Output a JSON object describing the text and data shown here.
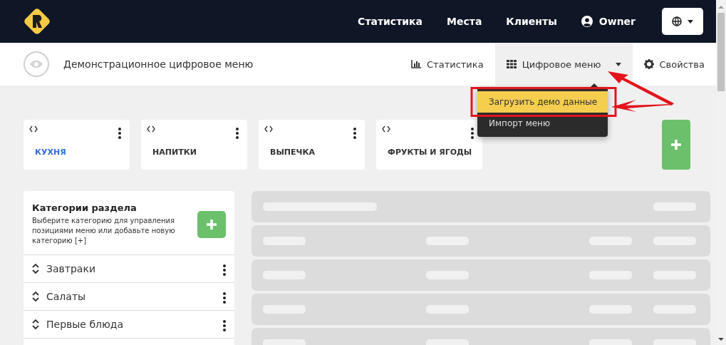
{
  "topbar": {
    "nav": [
      {
        "label": "Статистика"
      },
      {
        "label": "Места"
      },
      {
        "label": "Клиенты"
      }
    ],
    "user": "Owner"
  },
  "subheader": {
    "title": "Демонстрационное цифровое меню",
    "tabs": [
      {
        "label": "Статистика",
        "kind": "chart",
        "selected": false
      },
      {
        "label": "Цифровое меню",
        "kind": "grid",
        "selected": true,
        "expanded": true
      },
      {
        "label": "Свойства",
        "kind": "gear",
        "selected": false
      }
    ]
  },
  "dropdown": {
    "items": [
      {
        "label": "Загрузить демо данные",
        "selected": true
      },
      {
        "label": "Импорт меню",
        "selected": false
      }
    ]
  },
  "sections": [
    {
      "label": "КУХНЯ",
      "selected": true
    },
    {
      "label": "НАПИТКИ",
      "selected": false
    },
    {
      "label": "ВЫПЕЧКА",
      "selected": false
    },
    {
      "label": "ФРУКТЫ И ЯГОДЫ",
      "selected": false
    }
  ],
  "categories_panel": {
    "title": "Категории раздела",
    "description": "Выберите категорию для управления позициями меню или добавьте новую категорию [+]",
    "categories": [
      {
        "label": "Завтраки"
      },
      {
        "label": "Салаты"
      },
      {
        "label": "Первые блюда"
      }
    ]
  },
  "skeleton_rows": [
    {
      "kind": "header"
    },
    {
      "kind": "row"
    },
    {
      "kind": "row"
    },
    {
      "kind": "row"
    },
    {
      "kind": "row"
    }
  ]
}
